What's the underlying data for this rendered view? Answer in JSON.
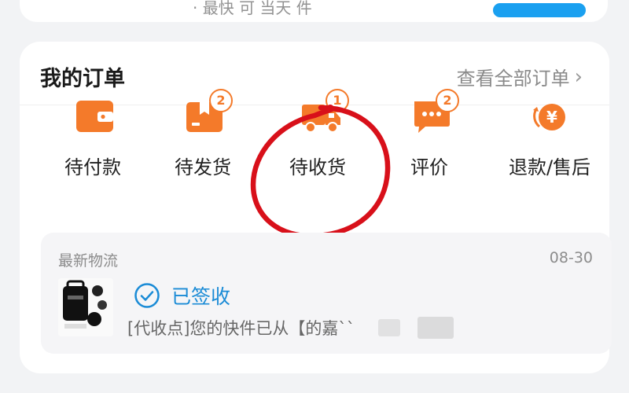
{
  "top_card": {
    "partial_text": "· 最快 可 当天 件",
    "action_button_color": "#1aa0f0"
  },
  "orders": {
    "title": "我的订单",
    "view_all": "查看全部订单",
    "statuses": [
      {
        "label": "待付款",
        "icon": "wallet-icon",
        "badge": null
      },
      {
        "label": "待发货",
        "icon": "package-icon",
        "badge": "2"
      },
      {
        "label": "待收货",
        "icon": "truck-icon",
        "badge": "1"
      },
      {
        "label": "评价",
        "icon": "comment-icon",
        "badge": "2"
      },
      {
        "label": "退款/售后",
        "icon": "refund-icon",
        "badge": null
      }
    ]
  },
  "logistics": {
    "title": "最新物流",
    "date": "08-30",
    "status": "已签收",
    "detail": "[代收点]您的快件已从【的嘉``"
  },
  "colors": {
    "accent_orange": "#f47a2a",
    "signed_blue": "#1a8bd6",
    "annotation_red": "#d8101a"
  }
}
